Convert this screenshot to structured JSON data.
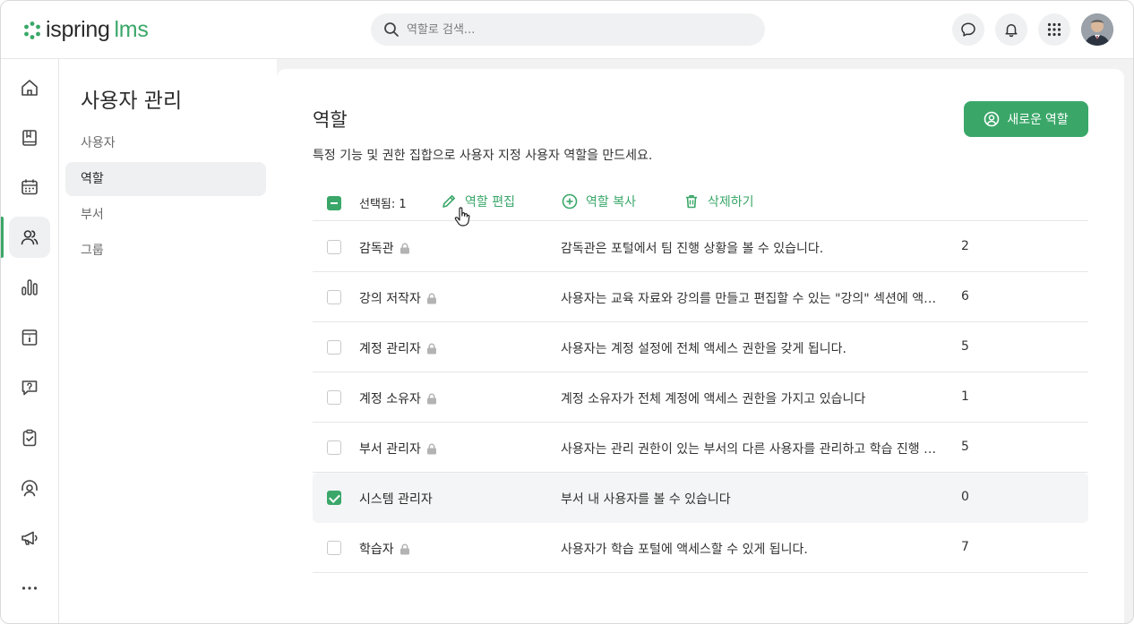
{
  "header": {
    "logo_name": "ispring",
    "logo_suffix": "lms",
    "search_placeholder": "역할로 검색..."
  },
  "rail": {
    "items": [
      "home-icon",
      "book-icon",
      "calendar-icon",
      "users-icon",
      "chart-icon",
      "info-board-icon",
      "help-chat-icon",
      "clipboard-check-icon",
      "coach-icon",
      "megaphone-icon",
      "more-icon"
    ],
    "active": "users-icon"
  },
  "subnav": {
    "title": "사용자 관리",
    "items": [
      {
        "label": "사용자"
      },
      {
        "label": "역할",
        "active": true
      },
      {
        "label": "부서"
      },
      {
        "label": "그룹"
      }
    ]
  },
  "main": {
    "title": "역할",
    "description": "특정 기능 및 권한 집합으로 사용자 지정 사용자 역할을 만드세요.",
    "new_role_label": "새로운 역할",
    "toolbar": {
      "selected_label": "선택됨: 1",
      "edit_label": "역할 편집",
      "copy_label": "역할 복사",
      "delete_label": "삭제하기"
    },
    "roles": [
      {
        "name": "감독관",
        "locked": true,
        "description": "감독관은 포털에서 팀 진행 상황을 볼 수 있습니다.",
        "count": "2",
        "checked": false
      },
      {
        "name": "강의 저작자",
        "locked": true,
        "description": "사용자는 교육 자료와 강의를 만들고 편집할 수 있는 \"강의\" 섹션에 액세스할 수 있습니다.",
        "count": "6",
        "checked": false
      },
      {
        "name": "계정 관리자",
        "locked": true,
        "description": "사용자는 계정 설정에 전체 액세스 권한을 갖게 됩니다.",
        "count": "5",
        "checked": false
      },
      {
        "name": "계정 소유자",
        "locked": true,
        "description": "계정 소유자가 전체 계정에 액세스 권한을 가지고 있습니다",
        "count": "1",
        "checked": false
      },
      {
        "name": "부서 관리자",
        "locked": true,
        "description": "사용자는 관리 권한이 있는 부서의 다른 사용자를 관리하고 학습 진행 상황을 볼 수 있습니다.",
        "count": "5",
        "checked": false
      },
      {
        "name": "시스템 관리자",
        "locked": false,
        "description": "부서 내 사용자를 볼 수 있습니다",
        "count": "0",
        "checked": true
      },
      {
        "name": "학습자",
        "locked": true,
        "description": "사용자가 학습 포털에 액세스할 수 있게 됩니다.",
        "count": "7",
        "checked": false
      }
    ]
  },
  "colors": {
    "accent": "#3aa769",
    "text": "#2b2b2b",
    "muted": "#6b6b6b",
    "surface": "#f2f2f2"
  }
}
